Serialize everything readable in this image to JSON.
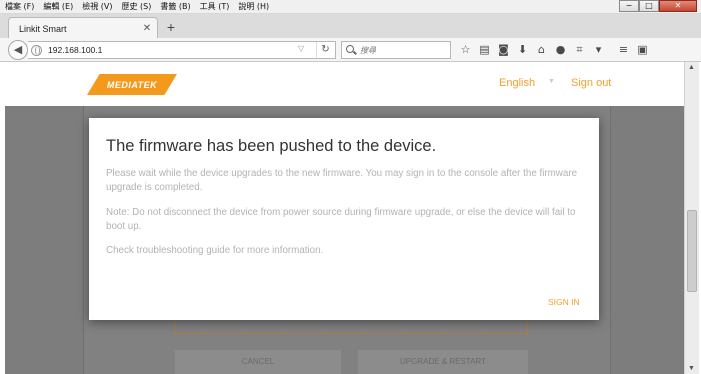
{
  "browser": {
    "menu": [
      "檔案 (F)",
      "編輯 (E)",
      "檢視 (V)",
      "歷史 (S)",
      "書籤 (B)",
      "工具 (T)",
      "說明 (H)"
    ],
    "window_controls": [
      "−",
      "□",
      "✕"
    ],
    "tab": {
      "title": "Linkit Smart",
      "close": "✕"
    },
    "new_tab": "+",
    "url": "192.168.100.1",
    "search_placeholder": "搜尋",
    "toolbar_icons": [
      "star-icon",
      "reading-list-icon",
      "pocket-icon",
      "download-icon",
      "home-icon",
      "chat-icon",
      "screenshot-icon",
      "overflow-icon",
      "hamburger-menu-icon",
      "extension-icon"
    ]
  },
  "header": {
    "logo": "MEDIATEK",
    "language": "English",
    "signout": "Sign out"
  },
  "background": {
    "cancel_label": "CANCEL",
    "upgrade_label": "UPGRADE & RESTART"
  },
  "modal": {
    "title": "The firmware has been pushed to the device.",
    "paragraph1": "Please wait while the device upgrades to the new firmware. You may sign in to the console after the firmware upgrade is completed.",
    "paragraph2": "Note: Do not disconnect the device from power source during firmware upgrade, or else the device will fail to boot up.",
    "paragraph3": "Check troubleshooting guide for more information.",
    "action": "SIGN IN"
  },
  "colors": {
    "accent": "#f2a12b",
    "logo_bg": "#f39a1d",
    "overlay": "#7d7d7d"
  }
}
